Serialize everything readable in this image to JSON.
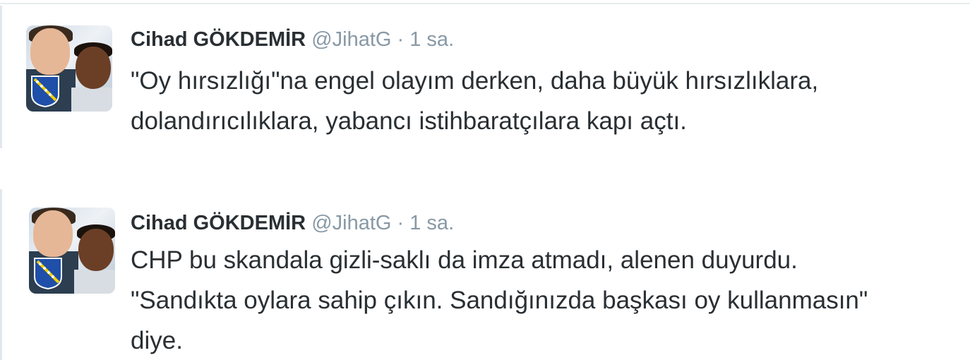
{
  "tweets": [
    {
      "author": {
        "name": "Cihad GÖKDEMİR",
        "handle": "@JihatG"
      },
      "separator": "·",
      "time": "1 sa.",
      "lines": [
        "\"Oy hırsızlığı\"na engel olayım derken, daha büyük hırsızlıklara,",
        "dolandırıcılıklara, yabancı istihbaratçılara kapı açtı."
      ]
    },
    {
      "author": {
        "name": "Cihad GÖKDEMİR",
        "handle": "@JihatG"
      },
      "separator": "·",
      "time": "1 sa.",
      "lines": [
        "CHP bu skandala gizli-saklı da imza atmadı, alenen duyurdu.",
        "\"Sandıkta oylara sahip çıkın. Sandığınızda başkası oy kullanmasın\"",
        "diye."
      ]
    }
  ],
  "colors": {
    "text": "#292f33",
    "muted": "#8899a6",
    "border": "#e1e8ed"
  }
}
